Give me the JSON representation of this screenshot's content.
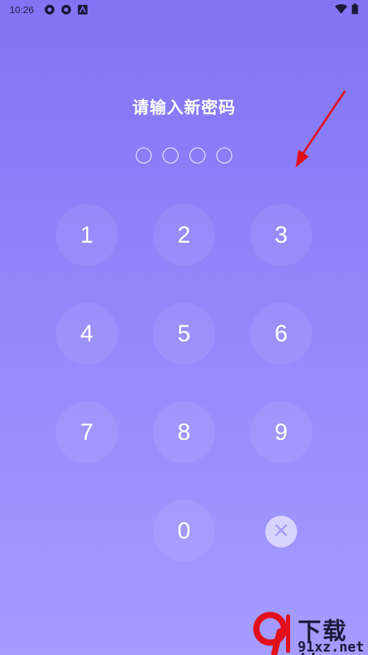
{
  "status_bar": {
    "time": "10:26",
    "left_icons": [
      "aperture-icon",
      "aperture-icon",
      "a-letter-icon"
    ],
    "right_icons": [
      "wifi-icon",
      "battery-icon"
    ]
  },
  "title": "请输入新密码",
  "pin_length": 4,
  "keypad": {
    "keys": [
      "1",
      "2",
      "3",
      "4",
      "5",
      "6",
      "7",
      "8",
      "9",
      "0"
    ],
    "delete_icon": "close-x-icon"
  },
  "watermark": {
    "text": "下载站",
    "url": "91xz.net",
    "logo": "9f-logo"
  },
  "colors": {
    "bg_top": "#8174f4",
    "bg_bottom": "#a49cff",
    "annotation_arrow": "#e2101b"
  }
}
